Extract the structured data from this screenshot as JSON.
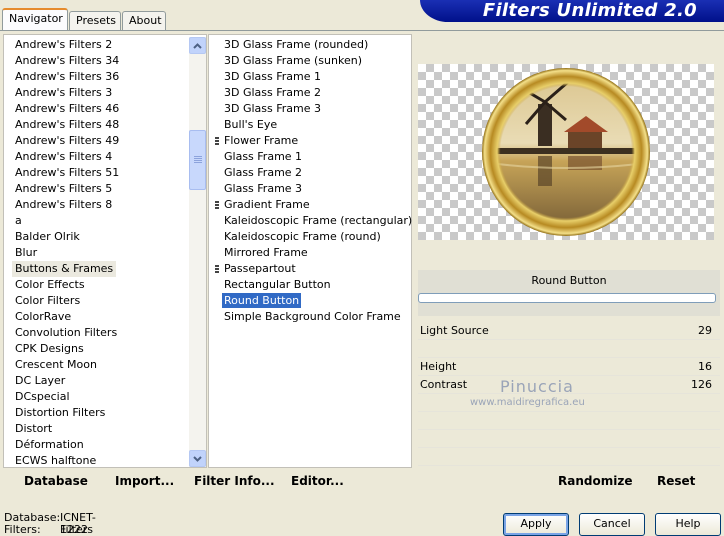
{
  "tabs": [
    "Navigator",
    "Presets",
    "About"
  ],
  "app_title": "Filters Unlimited 2.0",
  "categories": [
    "Andrew's Filters 2",
    "Andrew's Filters 34",
    "Andrew's Filters 36",
    "Andrew's Filters 3",
    "Andrew's Filters 46",
    "Andrew's Filters 48",
    "Andrew's Filters 49",
    "Andrew's Filters 4",
    "Andrew's Filters 51",
    "Andrew's Filters 5",
    "Andrew's Filters 8",
    "a",
    "Balder Olrik",
    "Blur",
    "Buttons & Frames",
    "Color Effects",
    "Color Filters",
    "ColorRave",
    "Convolution Filters",
    "CPK Designs",
    "Crescent Moon",
    "DC Layer",
    "DCspecial",
    "Distortion Filters",
    "Distort",
    "Déformation",
    "ECWS halftone"
  ],
  "selected_category_index": 14,
  "filters": [
    {
      "label": "3D Glass Frame (rounded)",
      "grip": false
    },
    {
      "label": "3D Glass Frame (sunken)",
      "grip": false
    },
    {
      "label": "3D Glass Frame 1",
      "grip": false
    },
    {
      "label": "3D Glass Frame 2",
      "grip": false
    },
    {
      "label": "3D Glass Frame 3",
      "grip": false
    },
    {
      "label": "Bull's Eye",
      "grip": false
    },
    {
      "label": "Flower Frame",
      "grip": true
    },
    {
      "label": "Glass Frame 1",
      "grip": false
    },
    {
      "label": "Glass Frame 2",
      "grip": false
    },
    {
      "label": "Glass Frame 3",
      "grip": false
    },
    {
      "label": "Gradient Frame",
      "grip": true
    },
    {
      "label": "Kaleidoscopic Frame (rectangular)",
      "grip": false
    },
    {
      "label": "Kaleidoscopic Frame (round)",
      "grip": false
    },
    {
      "label": "Mirrored Frame",
      "grip": false
    },
    {
      "label": "Passepartout",
      "grip": true
    },
    {
      "label": "Rectangular Button",
      "grip": false
    },
    {
      "label": "Round Button",
      "grip": false
    },
    {
      "label": "Simple Background Color Frame",
      "grip": false
    }
  ],
  "selected_filter_index": 16,
  "filter_name": "Round Button",
  "params": [
    {
      "label": "Light Source",
      "value": "29"
    },
    {
      "label": "",
      "value": ""
    },
    {
      "label": "Height",
      "value": "16"
    },
    {
      "label": "Contrast",
      "value": "126"
    },
    {
      "label": "",
      "value": ""
    },
    {
      "label": "",
      "value": ""
    },
    {
      "label": "",
      "value": ""
    },
    {
      "label": "",
      "value": ""
    }
  ],
  "watermark": {
    "name": "Pinuccia",
    "site": "www.maidiregrafica.eu"
  },
  "left_buttons": {
    "database": "Database",
    "import": "Import...",
    "filter_info": "Filter Info...",
    "editor": "Editor..."
  },
  "right_buttons": {
    "randomize": "Randomize",
    "reset": "Reset"
  },
  "status": {
    "database_label": "Database:",
    "database_value": "ICNET-Filters",
    "filters_label": "Filters:",
    "filters_value": "1222"
  },
  "dialog_buttons": {
    "apply": "Apply",
    "cancel": "Cancel",
    "help": "Help"
  }
}
